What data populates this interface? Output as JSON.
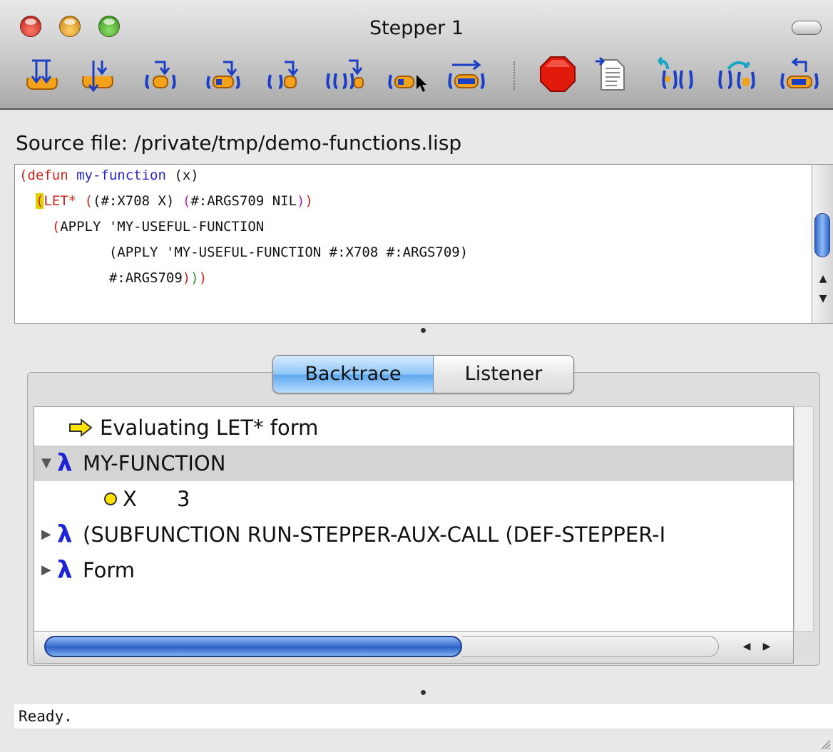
{
  "window": {
    "title": "Stepper 1"
  },
  "toolbar": {
    "buttons": [
      "step-into-icon",
      "step-over-icon",
      "step-next-icon",
      "step-to-value-icon",
      "step-to-call-icon",
      "step-through-call-icon",
      "step-to-cursor-icon",
      "step-to-end-icon",
      "stop-icon",
      "show-source-icon",
      "undo-step-icon",
      "restart-icon",
      "return-icon"
    ]
  },
  "source": {
    "label": "Source file: /private/tmp/demo-functions.lisp",
    "lines": [
      "(defun my-function (x)",
      "  (LET* ((#:X708 X) (#:ARGS709 NIL))",
      "    (APPLY 'MY-USEFUL-FUNCTION",
      "           (APPLY 'MY-USEFUL-FUNCTION #:X708 #:ARGS709)",
      "           #:ARGS709)))"
    ]
  },
  "tabs": {
    "active": "Backtrace",
    "inactive": "Listener"
  },
  "backtrace": {
    "rows": [
      {
        "text": "Evaluating LET* form"
      },
      {
        "text": "MY-FUNCTION"
      },
      {
        "name": "X",
        "value": "3"
      },
      {
        "text": "(SUBFUNCTION RUN-STEPPER-AUX-CALL (DEF-STEPPER-I"
      },
      {
        "text": "Form"
      }
    ]
  },
  "status": {
    "text": "Ready."
  },
  "colors": {
    "lambda": "#1e24d6",
    "selection": "#d4d4d4",
    "code_red": "#d1241c",
    "code_blue": "#2626c8"
  }
}
